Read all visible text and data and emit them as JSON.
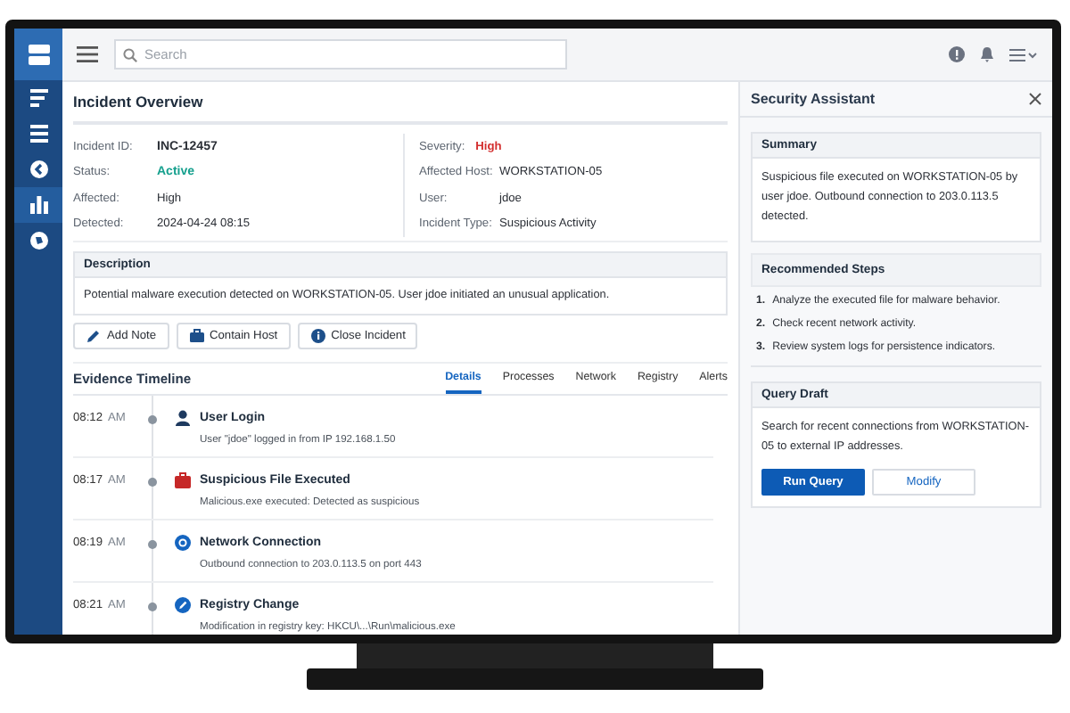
{
  "sidebar": {
    "items": [
      {
        "selected": false
      },
      {
        "selected": false
      },
      {
        "selected": false
      },
      {
        "selected": true
      },
      {
        "selected": false
      }
    ]
  },
  "topbar": {
    "search": {
      "placeholder": "Search"
    }
  },
  "overview": {
    "title": "Incident Overview",
    "left_fields": [
      {
        "label": "Incident ID:",
        "value": "INC-12457",
        "kind": "id"
      },
      {
        "label": "Status:",
        "value": "Active",
        "kind": "status"
      },
      {
        "label": "Affected:",
        "value": "High",
        "kind": "plain"
      },
      {
        "label": "Detected:",
        "value": "2024-04-24 08:15",
        "kind": "plain"
      }
    ],
    "right_fields": [
      {
        "label": "Severity:",
        "value": "High",
        "kind": "severity"
      },
      {
        "label": "Affected Host:",
        "value": "WORKSTATION-05",
        "kind": "plain"
      },
      {
        "label": "User:",
        "value": "jdoe",
        "kind": "plain"
      },
      {
        "label": "Incident Type:",
        "value": "Suspicious Activity",
        "kind": "plain"
      }
    ]
  },
  "description": {
    "title": "Description",
    "text": "Potential malware execution detected on WORKSTATION-05. User jdoe initiated an unusual application."
  },
  "actions": [
    {
      "label": "Add Note"
    },
    {
      "label": "Contain Host"
    },
    {
      "label": "Close Incident"
    }
  ],
  "timeline": {
    "title": "Evidence Timeline",
    "tabs": [
      {
        "label": "Details",
        "selected": true
      },
      {
        "label": "Processes",
        "selected": false
      },
      {
        "label": "Network",
        "selected": false
      },
      {
        "label": "Registry",
        "selected": false
      },
      {
        "label": "Alerts",
        "selected": false
      }
    ],
    "events": [
      {
        "time": "08:12",
        "ampm": "AM",
        "title": "User Login",
        "detail": "User \"jdoe\" logged in from IP 192.168.1.50",
        "kind": "user"
      },
      {
        "time": "08:17",
        "ampm": "AM",
        "title": "Suspicious File Executed",
        "detail": "Malicious.exe executed: Detected as suspicious",
        "kind": "file"
      },
      {
        "time": "08:19",
        "ampm": "AM",
        "title": "Network Connection",
        "detail": "Outbound connection to 203.0.113.5 on port 443",
        "kind": "network"
      },
      {
        "time": "08:21",
        "ampm": "AM",
        "title": "Registry Change",
        "detail": "Modification in registry key: HKCU\\...\\Run\\malicious.exe",
        "kind": "registry"
      }
    ]
  },
  "assistant": {
    "title": "Security Assistant",
    "summary": {
      "title": "Summary",
      "text": "Suspicious file executed on WORKSTATION-05 by user jdoe. Outbound connection to 203.0.113.5 detected."
    },
    "steps": {
      "title": "Recommended Steps",
      "items": [
        {
          "number": "1.",
          "text": "Analyze the executed file for malware behavior."
        },
        {
          "number": "2.",
          "text": "Check recent network activity."
        },
        {
          "number": "3.",
          "text": "Review system logs for persistence indicators."
        }
      ]
    },
    "query": {
      "title": "Query Draft",
      "text": "Search for recent connections from WORKSTATION-05 to external IP addresses.",
      "buttons": [
        {
          "label": "Run Query",
          "kind": "primary"
        },
        {
          "label": "Modify",
          "kind": "secondary"
        }
      ]
    }
  }
}
